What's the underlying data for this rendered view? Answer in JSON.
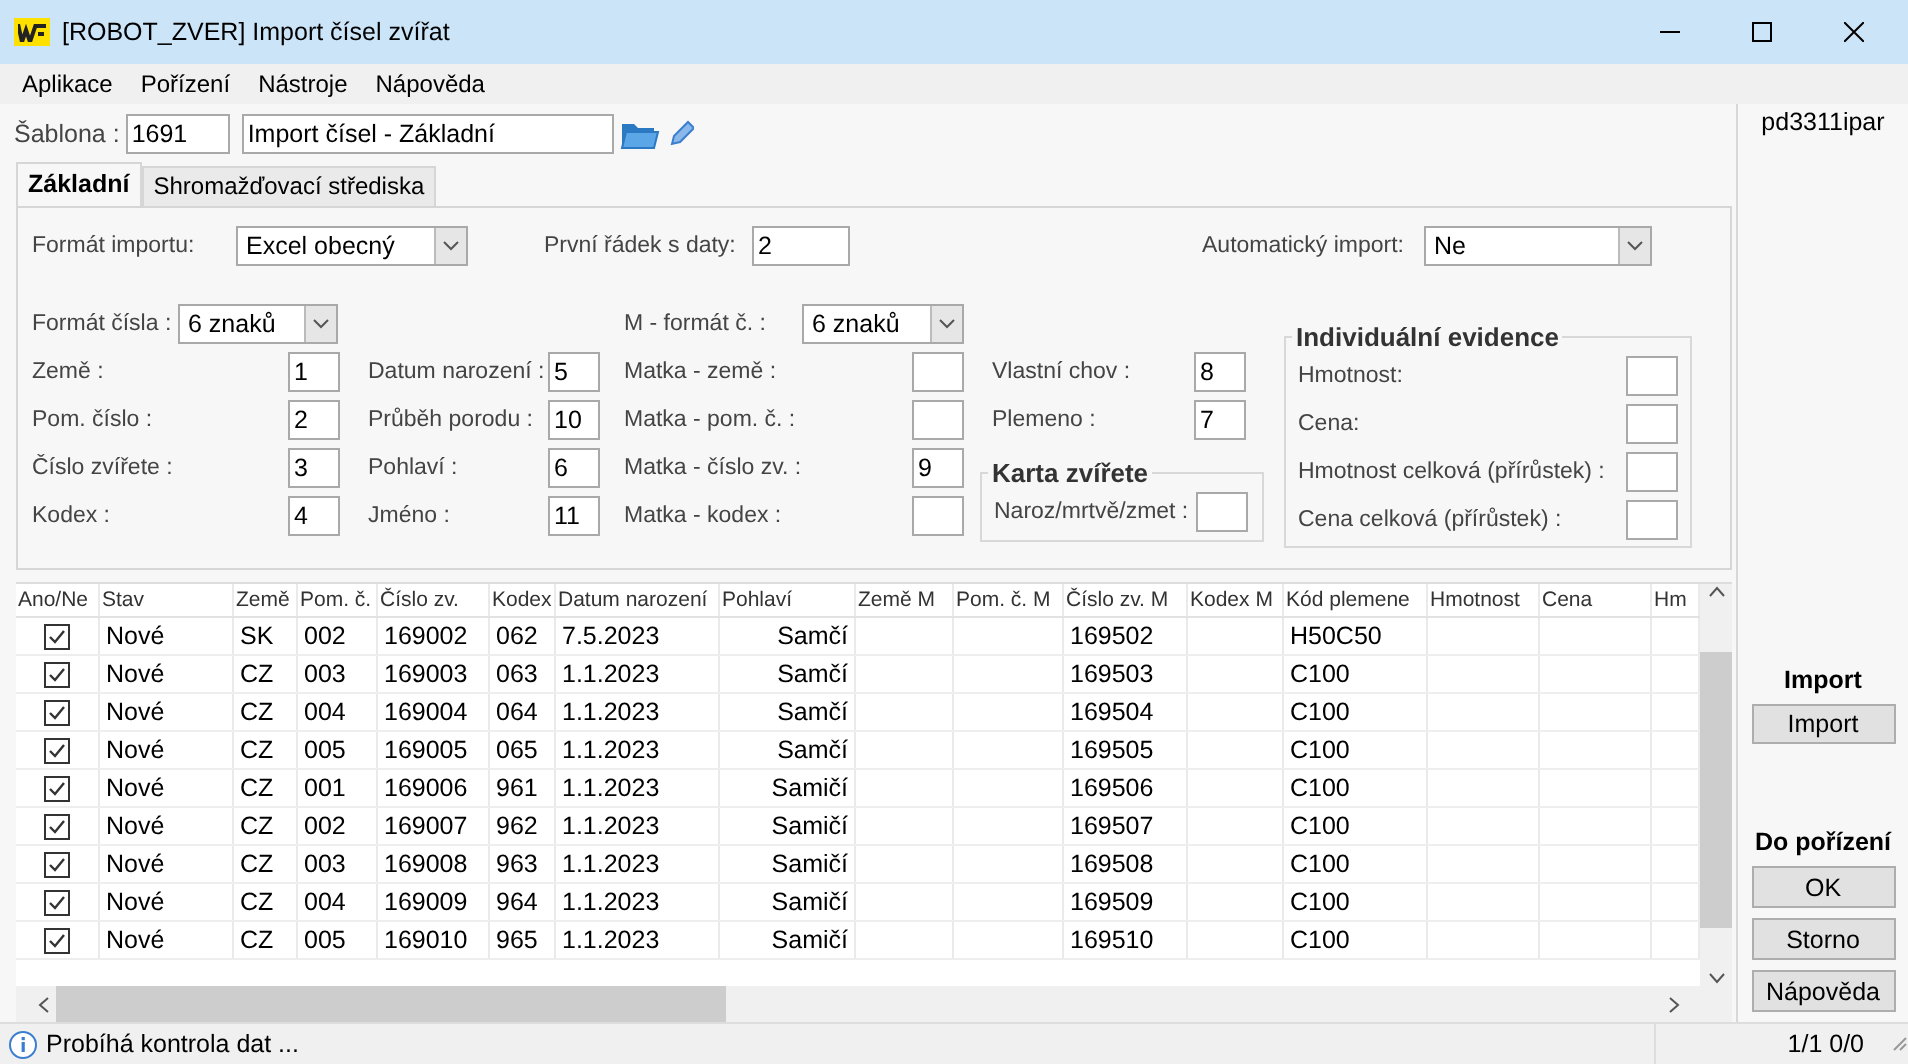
{
  "window": {
    "title": "[ROBOT_ZVER] Import čísel zvířat"
  },
  "menu": [
    "Aplikace",
    "Pořízení",
    "Nástroje",
    "Nápověda"
  ],
  "template": {
    "label": "Šablona :",
    "code": "1691",
    "name": "Import čísel - Základní"
  },
  "tabs": [
    {
      "label": "Základní",
      "selected": true
    },
    {
      "label": "Shromažďovací střediska",
      "selected": false
    }
  ],
  "form": {
    "top": [
      {
        "kind": "select",
        "label": "Formát importu:",
        "value": "Excel obecný"
      },
      {
        "kind": "input",
        "label": "První řádek s daty:",
        "value": "2"
      },
      {
        "kind": "select",
        "label": "Automatický import:",
        "value": "Ne"
      }
    ],
    "number_format": {
      "label": "Formát čísla :",
      "value": "6 znaků"
    },
    "fields_left": [
      {
        "label": "Země :",
        "value": "1"
      },
      {
        "label": "Pom. číslo :",
        "value": "2"
      },
      {
        "label": "Číslo zvířete :",
        "value": "3"
      },
      {
        "label": "Kodex :",
        "value": "4"
      }
    ],
    "fields_middle": [
      {
        "label": "Datum narození :",
        "value": "5"
      },
      {
        "label": "Průběh porodu :",
        "value": "10"
      },
      {
        "label": "Pohlaví :",
        "value": "6"
      },
      {
        "label": "Jméno :",
        "value": "11"
      }
    ],
    "mother_format": {
      "label": "M - formát č. :",
      "value": "6 znaků"
    },
    "mother_fields": [
      {
        "label": "Matka - země :"
      },
      {
        "label": "Matka - pom. č. :"
      },
      {
        "label": "Matka - číslo zv. :",
        "value": "9"
      },
      {
        "label": "Matka - kodex :"
      }
    ],
    "own_fields": [
      {
        "label": "Vlastní chov :",
        "value": "8"
      },
      {
        "label": "Plemeno :",
        "value": "7"
      }
    ],
    "animal_card": {
      "title": "Karta zvířete",
      "fields": [
        {
          "label": "Naroz/mrtvě/zmet :"
        }
      ]
    },
    "individual_records": {
      "title": "Individuální evidence",
      "fields": [
        {
          "label": "Hmotnost:"
        },
        {
          "label": "Cena:"
        },
        {
          "label": "Hmotnost celková (přírůstek) :"
        },
        {
          "label": "Cena celková (přírůstek) :"
        }
      ]
    }
  },
  "grid": {
    "columns": [
      "Ano/Ne",
      "Stav",
      "Země",
      "Pom. č.",
      "Číslo zv.",
      "Kodex",
      "Datum narození",
      "Pohlaví",
      "Země M",
      "Pom. č. M",
      "Číslo zv. M",
      "Kodex M",
      "Kód plemene",
      "Hmotnost",
      "Cena",
      "Hm"
    ],
    "rows": [
      {
        "cells": [
          {
            "checked": true
          },
          "Nové",
          "SK",
          "002",
          "169002",
          "062",
          "7.5.2023",
          "Samčí",
          null,
          null,
          "169502",
          null,
          "H50C50",
          null,
          null,
          null
        ]
      },
      {
        "cells": [
          {
            "checked": true
          },
          "Nové",
          "CZ",
          "003",
          "169003",
          "063",
          "1.1.2023",
          "Samčí",
          null,
          null,
          "169503",
          null,
          "C100",
          null,
          null,
          null
        ]
      },
      {
        "cells": [
          {
            "checked": true
          },
          "Nové",
          "CZ",
          "004",
          "169004",
          "064",
          "1.1.2023",
          "Samčí",
          null,
          null,
          "169504",
          null,
          "C100",
          null,
          null,
          null
        ]
      },
      {
        "cells": [
          {
            "checked": true
          },
          "Nové",
          "CZ",
          "005",
          "169005",
          "065",
          "1.1.2023",
          "Samčí",
          null,
          null,
          "169505",
          null,
          "C100",
          null,
          null,
          null
        ]
      },
      {
        "cells": [
          {
            "checked": true
          },
          "Nové",
          "CZ",
          "001",
          "169006",
          "961",
          "1.1.2023",
          "Samičí",
          null,
          null,
          "169506",
          null,
          "C100",
          null,
          null,
          null
        ]
      },
      {
        "cells": [
          {
            "checked": true
          },
          "Nové",
          "CZ",
          "002",
          "169007",
          "962",
          "1.1.2023",
          "Samičí",
          null,
          null,
          "169507",
          null,
          "C100",
          null,
          null,
          null
        ]
      },
      {
        "cells": [
          {
            "checked": true
          },
          "Nové",
          "CZ",
          "003",
          "169008",
          "963",
          "1.1.2023",
          "Samičí",
          null,
          null,
          "169508",
          null,
          "C100",
          null,
          null,
          null
        ]
      },
      {
        "cells": [
          {
            "checked": true
          },
          "Nové",
          "CZ",
          "004",
          "169009",
          "964",
          "1.1.2023",
          "Samičí",
          null,
          null,
          "169509",
          null,
          "C100",
          null,
          null,
          null
        ]
      },
      {
        "cells": [
          {
            "checked": true
          },
          "Nové",
          "CZ",
          "005",
          "169010",
          "965",
          "1.1.2023",
          "Samičí",
          null,
          null,
          "169510",
          null,
          "C100",
          null,
          null,
          null
        ]
      }
    ]
  },
  "side": {
    "user": "pd3311ipar",
    "groups": [
      {
        "title": "Import",
        "buttons": [
          "Import"
        ]
      },
      {
        "title": "Do pořízení",
        "buttons": [
          "OK",
          "Storno",
          "Nápověda"
        ]
      }
    ]
  },
  "status_bar": {
    "message": "Probíhá kontrola dat ...",
    "counts": "1/1 0/0"
  }
}
